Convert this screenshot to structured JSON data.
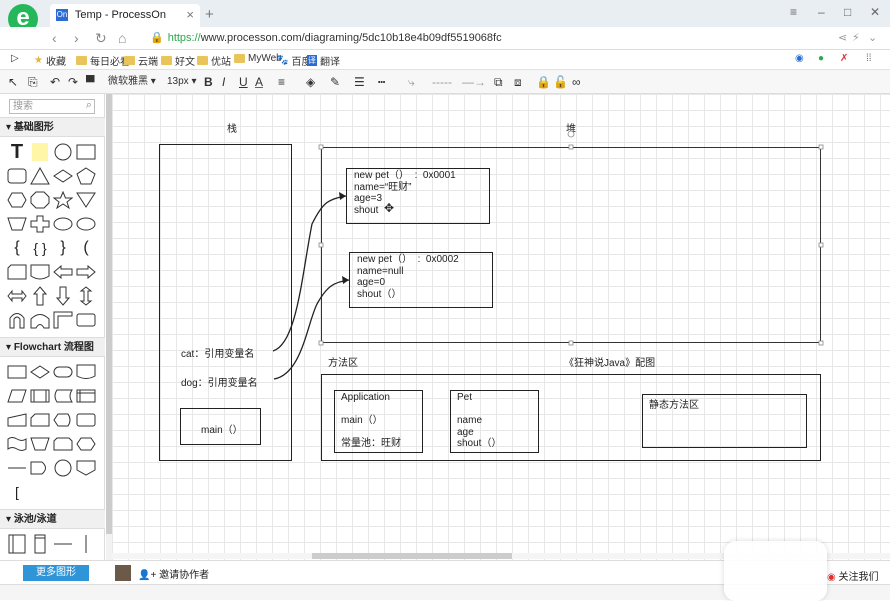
{
  "browser": {
    "tab_favicon": "On",
    "tab_title": "Temp - ProcessOn",
    "url_prefix": "https://",
    "url_rest": "www.processon.com/diagraming/5dc10b18e4b09df5519068fc",
    "bookmarks": [
      "收藏",
      "每日必看",
      "云端",
      "好文",
      "优站",
      "MyWeb",
      "百度",
      "翻译"
    ]
  },
  "toolbar": {
    "font_family": "微软雅黑",
    "font_size": "13px",
    "bold": "B",
    "italic": "I",
    "underline": "U",
    "font_color": "A"
  },
  "sidebar": {
    "search_placeholder": "搜索",
    "section_basic": "基础图形",
    "section_flowchart": "Flowchart 流程图",
    "section_swimlane": "泳池/泳道",
    "more_shapes": "更多图形"
  },
  "diagram": {
    "stack_label": "栈",
    "heap_label": "堆",
    "cat_ref": "cat：引用变量名",
    "dog_ref": "dog：引用变量名",
    "main_method": "main（）",
    "pet1_lines": "new pet（）  :  0x0001\nname=“旺财”\nage=3\nshout",
    "pet2_lines": "new pet（）  :  0x0002\nname=null\nage=0\nshout（）",
    "method_area": "方法区",
    "book_caption": "《狂神说Java》配图",
    "application_lines": "Application\n\nmain（）\n\n常量池：旺财",
    "pet_class_lines": "Pet\n\nname\nage\nshout（）",
    "static_area": "静态方法区"
  },
  "footer": {
    "invite": "邀请协作者",
    "follow": "关注我们"
  },
  "colors": {
    "accent": "#2f95d8",
    "brand_green": "#25b85a",
    "tab_active": "#ffffff",
    "grid": "#e7e7e7"
  }
}
